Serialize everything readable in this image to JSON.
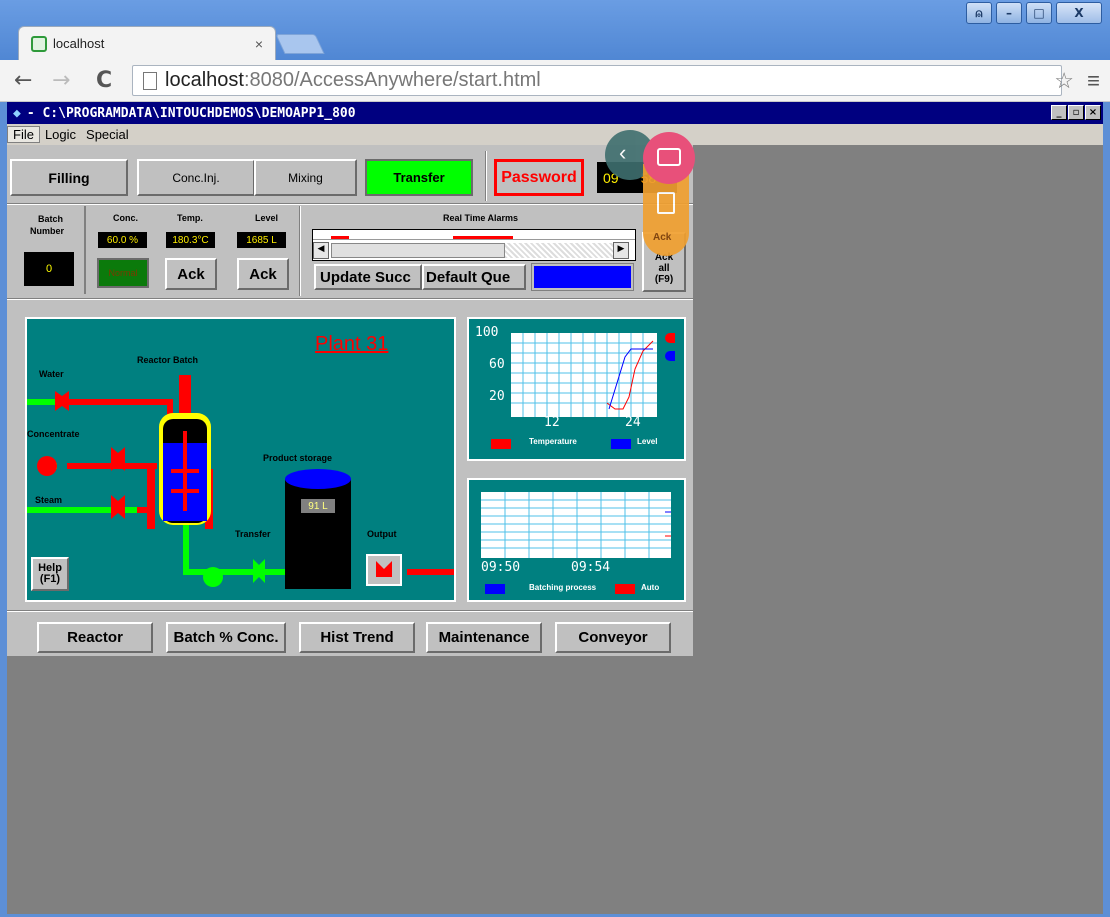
{
  "browser": {
    "tab_title": "localhost",
    "tab_close": "×",
    "url_host": "localhost",
    "url_rest": ":8080/AccessAnywhere/start.html",
    "back": "←",
    "forward": "→",
    "reload": "C",
    "star": "☆",
    "menu": "≡",
    "win_user": "⍝",
    "win_min": "–",
    "win_max": "□",
    "win_close": "X"
  },
  "app": {
    "title": "- C:\\PROGRAMDATA\\INTOUCHDEMOS\\DEMOAPP1_800",
    "menu": [
      "File",
      "Logic",
      "Special"
    ],
    "top_buttons": {
      "filling": "Filling",
      "conc_inj": "Conc.Inj.",
      "mixing": "Mixing",
      "transfer": "Transfer",
      "password": "Password"
    },
    "clock": {
      "hours": "09",
      "minutes": "58"
    },
    "batch": {
      "label_line1": "Batch",
      "label_line2": "Number",
      "value": "0"
    },
    "conc": {
      "label": "Conc.",
      "value": "60.0 %",
      "status": "Normal"
    },
    "temp": {
      "label": "Temp.",
      "value": "180.3°C",
      "ack": "Ack"
    },
    "level": {
      "label": "Level",
      "value": "1685 L",
      "ack": "Ack"
    },
    "alarms": {
      "label": "Real Time Alarms",
      "update": "Update Succ",
      "default": "Default Que",
      "ack_all_1": "Ack",
      "ack_all_2": "all",
      "ack_all_3": "(F9)",
      "ack_overlay": "Ack"
    },
    "plant": {
      "title": "Plant 31",
      "reactor": "Reactor Batch",
      "water": "Water",
      "concentrate": "Concentrate",
      "steam": "Steam",
      "product_storage": "Product storage",
      "storage_level": "91 L",
      "transfer": "Transfer",
      "output": "Output",
      "help": "Help (F1)"
    },
    "trend1": {
      "y_ticks": [
        "100",
        "60",
        "20"
      ],
      "x_ticks": [
        "12",
        "24"
      ],
      "legend": [
        "Temperature",
        "Level"
      ],
      "colors": [
        "#ff0000",
        "#0000ff"
      ]
    },
    "trend2": {
      "x_ticks": [
        "09:50",
        "09:54"
      ],
      "legend": [
        "Batching process",
        "Auto"
      ],
      "colors": [
        "#0000ff",
        "#ff0000"
      ]
    },
    "bottom_buttons": [
      "Reactor",
      "Batch % Conc.",
      "Hist Trend",
      "Maintenance",
      "Conveyor"
    ]
  },
  "colors": {
    "teal": "#008080",
    "transfer_green": "#00ff00",
    "password_red": "#ff0000",
    "pipe_red": "#ff0000",
    "pipe_green": "#00ff00",
    "overlay_pink": "#e8507a",
    "overlay_orange": "#f0a030"
  }
}
